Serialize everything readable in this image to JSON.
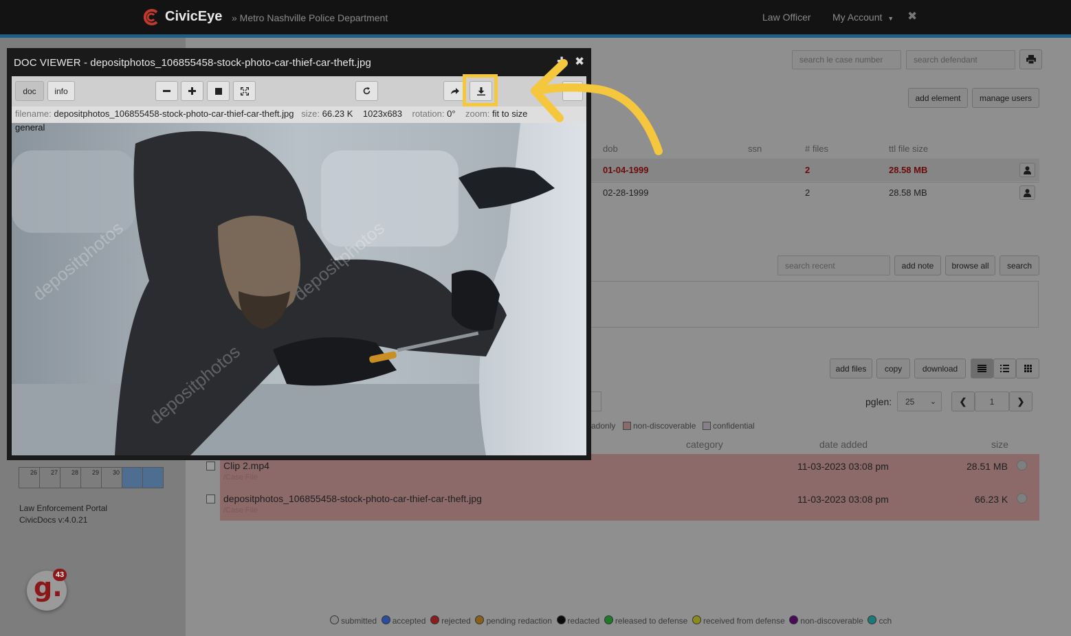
{
  "topnav": {
    "brand": "CivicEye",
    "department": "» Metro Nashville Police Department",
    "user_link": "Law Officer",
    "account_menu": "My Account",
    "close_glyph": "✖"
  },
  "search": {
    "case_number_placeholder": "search le case number",
    "defendant_placeholder": "search defendant"
  },
  "actions": {
    "add_element": "add element",
    "manage_users": "manage users"
  },
  "defendants_table": {
    "headers": {
      "dob": "dob",
      "ssn": "ssn",
      "files": "# files",
      "size": "ttl file size"
    },
    "rows": [
      {
        "dob": "01-04-1999",
        "files": "2",
        "size": "28.58 MB"
      },
      {
        "dob": "02-28-1999",
        "files": "2",
        "size": "28.58 MB"
      }
    ]
  },
  "notes": {
    "search_placeholder": "search recent",
    "add_note": "add note",
    "browse_all": "browse all",
    "search": "search"
  },
  "files": {
    "add_files": "add files",
    "copy": "copy",
    "download": "download",
    "pglen_label": "pglen:",
    "pglen_value": "25",
    "page_value": "1",
    "flags": [
      "adonly",
      "non-discoverable",
      "confidential"
    ],
    "headers": {
      "category": "category",
      "date_added": "date added",
      "size": "size"
    },
    "rows": [
      {
        "name": "Clip 2.mp4",
        "sub": "/Case File",
        "date": "11-03-2023 03:08 pm",
        "size": "28.51 MB"
      },
      {
        "name": "depositphotos_106855458-stock-photo-car-thief-car-theft.jpg",
        "sub": "/Case File",
        "date": "11-03-2023 03:08 pm",
        "size": "66.23 K"
      }
    ]
  },
  "calendar_last_row": [
    "26",
    "27",
    "28",
    "29",
    "30",
    "",
    ""
  ],
  "sidebar_footer": {
    "portal": "Law Enforcement Portal",
    "version": "CivicDocs v:4.0.21"
  },
  "badge": {
    "letter": "g.",
    "count": "43"
  },
  "status_legend": [
    {
      "label": "submitted",
      "color": "#8a8a8a"
    },
    {
      "label": "accepted",
      "color": "#2b4c9e"
    },
    {
      "label": "rejected",
      "color": "#8a1e1e"
    },
    {
      "label": "pending redaction",
      "color": "#8a5f1a"
    },
    {
      "label": "redacted",
      "color": "#0a0a0a"
    },
    {
      "label": "released to defense",
      "color": "#1e7a2a"
    },
    {
      "label": "received from defense",
      "color": "#8a8a1e"
    },
    {
      "label": "non-discoverable",
      "color": "#4a0a5a"
    },
    {
      "label": "cch",
      "color": "#1a7a7a"
    }
  ],
  "doc_viewer": {
    "title": "DOC VIEWER - depositphotos_106855458-stock-photo-car-thief-car-theft.jpg",
    "tabs": {
      "doc": "doc",
      "info": "info"
    },
    "info": {
      "filename_label": "filename:",
      "filename": "depositphotos_106855458-stock-photo-car-thief-car-theft.jpg",
      "size_label": "size:",
      "size": "66.23 K",
      "dimensions": "1023x683",
      "rotation_label": "rotation:",
      "rotation": "0°",
      "zoom_label": "zoom:",
      "zoom": "fit to size"
    },
    "category": "general",
    "photo_watermark": "depositphotos"
  },
  "annotation": {
    "arrow_color": "#f5c73d"
  }
}
